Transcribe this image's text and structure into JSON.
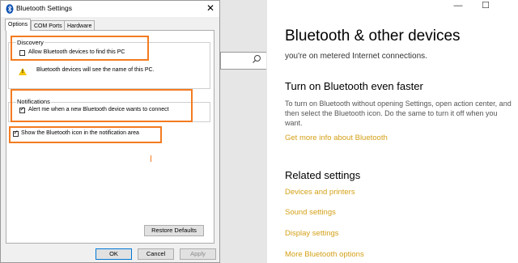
{
  "settings": {
    "window_controls": {
      "minimize": "—",
      "maximize": "☐"
    },
    "title": "Bluetooth & other devices",
    "metered_text": "you're on metered Internet connections.",
    "faster_heading": "Turn on Bluetooth even faster",
    "faster_para": "To turn on Bluetooth without opening Settings, open action center, and then select the Bluetooth icon. Do the same to turn it off when you want.",
    "more_info_link": "Get more info about Bluetooth",
    "related_heading": "Related settings",
    "links": [
      "Devices and printers",
      "Sound settings",
      "Display settings",
      "More Bluetooth options"
    ]
  },
  "dialog": {
    "title": "Bluetooth Settings",
    "close": "✕",
    "tabs": [
      "Options",
      "COM Ports",
      "Hardware"
    ],
    "discovery": {
      "label": "Discovery",
      "checkbox_label": "Allow Bluetooth devices to find this PC",
      "checked": false,
      "note": "Bluetooth devices will see the name of this PC."
    },
    "notifications": {
      "label": "Notifications",
      "checkbox_label": "Alert me when a new Bluetooth device wants to connect",
      "checked": true
    },
    "show_icon": {
      "checkbox_label": "Show the Bluetooth icon in the notification area",
      "checked": true
    },
    "buttons": {
      "restore": "Restore Defaults",
      "ok": "OK",
      "cancel": "Cancel",
      "apply": "Apply"
    }
  },
  "colors": {
    "highlight": "#f47b20",
    "link": "#d4a017",
    "accent": "#0078d7"
  }
}
